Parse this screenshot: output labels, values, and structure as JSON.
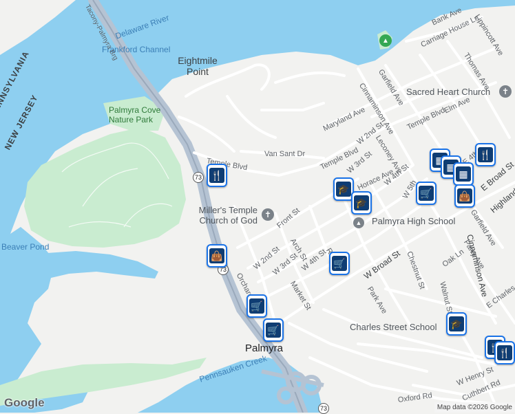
{
  "map": {
    "water_labels": [
      "Delaware River",
      "Frankford Channel",
      "Pennsauken Creek",
      "Beaver Pond"
    ],
    "park_labels": [
      "Palmyra Cove Nature Park"
    ],
    "state_labels": [
      "PENNSYLVANIA",
      "NEW JERSEY"
    ],
    "area_labels": [
      "Eightmile Point",
      "Palmyra"
    ],
    "bridge_label": "Tacony-Palmyra Brg",
    "streets": {
      "bank_ave": "Bank Ave",
      "lippincott": "Lippincott Ave",
      "carriage": "Carriage House Ln",
      "thomas": "Thomas Ave",
      "garfield": "Garfield Ave",
      "cinnaminson_n": "Cinnaminson Ave",
      "maryland": "Maryland Ave",
      "temple_blvd_e": "Temple Blvd",
      "elm": "Elm Ave",
      "w2nd_n": "W 2nd St",
      "leconey": "Leconey Ave",
      "van_sant": "Van Sant Dr",
      "temple_blvd_w": "Temple Blvd",
      "temple_blvd_mid": "Temple Blvd",
      "w3rd_n": "W 3rd St",
      "w4th_n": "W 4th St",
      "horace": "Horace Ave",
      "e4th": "E 4th St",
      "front": "Front St",
      "w2nd": "W 2nd St",
      "w3rd": "W 3rd St",
      "arch": "Arch St",
      "w4th": "W 4th St",
      "race": "Race St",
      "orchard": "Orchard",
      "market": "Market St",
      "w_broad": "W Broad St",
      "e_broad": "E Broad St",
      "highland": "Highland",
      "garfield_s": "Garfield Ave",
      "cinnaminson_s": "Cinnaminson Ave",
      "parry": "Parry Ave",
      "chestnut": "Chestnut St",
      "oak": "Oak Ln",
      "walnut": "Walnut St",
      "park_ave": "Park Ave",
      "e_charles": "E Charles",
      "w_henry": "W Henry St",
      "oxford": "Oxford Rd",
      "cuthbert": "Cuthbert Rd",
      "w5th": "W 5th"
    },
    "pois": {
      "sacred_heart": "Sacred Heart Church",
      "millers_temple": "Miller's Temple Church of God",
      "palmyra_hs": "Palmyra High School",
      "charles_street": "Charles Street School"
    },
    "route_shields": [
      "73",
      "73",
      "73"
    ],
    "google_logo": "Google",
    "attribution": "Map data ©2026 Google"
  },
  "colors": {
    "water": "#8ecff0",
    "land": "#f2f2f0",
    "park": "#c9ecd0",
    "highway": "#b5c3d3",
    "pin_border": "#1a73e8",
    "pin_icon": "#0f3d73"
  },
  "markers": [
    "restaurant",
    "shopping",
    "shopping",
    "shopping",
    "shopping",
    "school",
    "school",
    "school",
    "shopping",
    "shopping",
    "shopping",
    "shopping",
    "restaurant",
    "restaurant"
  ]
}
